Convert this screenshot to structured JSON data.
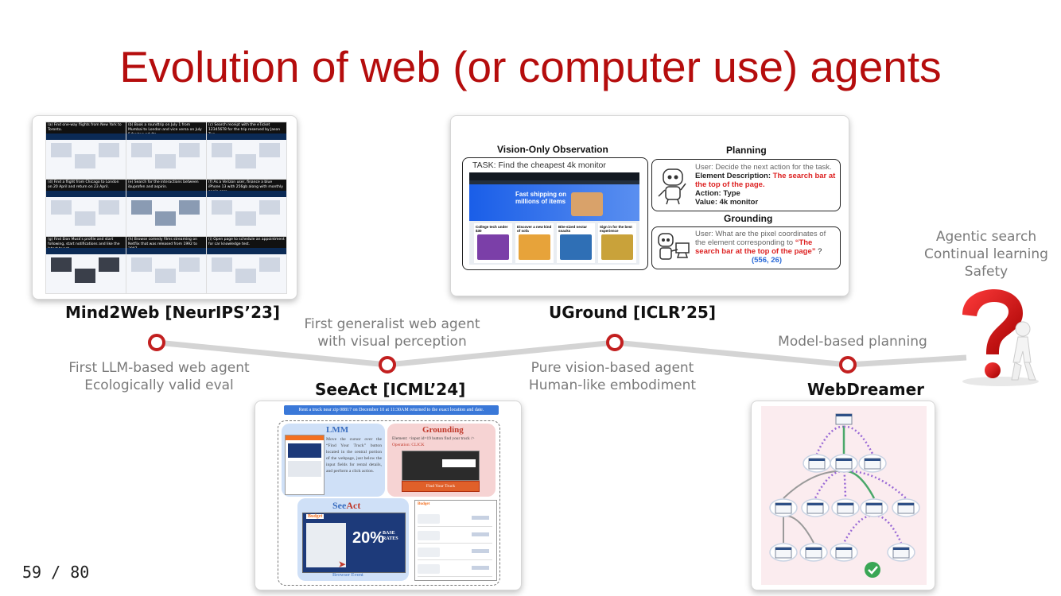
{
  "slide": {
    "title": "Evolution of web (or computer use) agents",
    "page_number": "59 / 80"
  },
  "colors": {
    "title_red": "#b50d0d",
    "node_red": "#c21f1f",
    "line_gray": "#d4d4d4",
    "text_gray": "#7a7a7a"
  },
  "milestones": [
    {
      "label": "Mind2Web [NeurIPS’23]",
      "description": [
        "First LLM-based web agent",
        "Ecologically valid eval"
      ]
    },
    {
      "label": "SeeAct [ICML’24]",
      "description": [
        "First generalist web agent",
        "with visual perception"
      ]
    },
    {
      "label": "UGround [ICLR’25]",
      "description": [
        "Pure vision-based agent",
        "Human-like embodiment"
      ]
    },
    {
      "label": "WebDreamer",
      "description": [
        "Model-based planning"
      ]
    }
  ],
  "future": {
    "lines": [
      "Agentic search",
      "Continual learning",
      "Safety"
    ],
    "icon": "question-mark-figure-icon"
  },
  "mind2web_figure": {
    "captions": [
      "(a) Find one-way flights from New York to Toronto.",
      "(b) Book a roundtrip on July 1 from Mumbai to London and vice versa on July 5 for two adults...",
      "(c) Search receipt with the eTicket 12345678 for the trip reserved by Jason Two",
      "(d) Find a flight from Chicago to London on 20 April and return on 23 April.",
      "(e) Search for the interactions between ibuprofen and aspirin.",
      "(f) As a Verizon user, finance a blue iPhone 13 with 256gb along with monthly apple care.",
      "(g) Find Elon Musk's profile and start following, start notifications and like the latest tweet.",
      "(h) Browse comedy films streaming on Netflix that was released from 1992 to 2007.",
      "(i) Open page to schedule an appointment for car knowledge test."
    ],
    "inner_texts": {
      "search_receipt": "Search receipt",
      "drugs_checker": "Drugs Interaction Checker",
      "logo": "ME"
    }
  },
  "uground_figure": {
    "observation_title": "Vision-Only Observation",
    "task": "TASK: Find the cheapest 4k monitor",
    "banner": "Fast shipping on millions of items",
    "products": [
      "College tech under $30",
      "Discover a new kind of sofa",
      "Bite-sized nectar snacks",
      "Sign in for the best experience"
    ],
    "planning_title": "Planning",
    "planning_user": "User: Decide the next action for the task.",
    "element_desc_label": "Element Description:",
    "element_desc_value": "The search bar at the top of the page.",
    "action_line": "Action: Type",
    "value_line": "Value: 4k monitor",
    "grounding_title": "Grounding",
    "grounding_user": "User: What are the pixel coordinates of the element corresponding to",
    "grounding_quote": "“The search bar at the top of the page”",
    "grounding_q": "?",
    "grounding_answer": "(556, 26)"
  },
  "seeact_figure": {
    "task": "Rent a truck near zip 08817 on December 10 at 11:30AM returned to the exact location and date.",
    "lmm_title": "LMM",
    "lmm_text": "Move the cursor over the “Find Your Truck” button located in the central portion of the webpage, just below the input fields for rental details, and perform a click action.",
    "grounding_title": "Grounding",
    "grounding_element": "Element: <input id=19 button find your truck />",
    "grounding_operation": "Operation: CLICK",
    "find_button": "Find Your Truck",
    "seeact_title_see": "See",
    "seeact_title_act": "Act",
    "promo": "20%",
    "promo_sub": "BASE RATES",
    "browser_event": "Browser Event",
    "brand": "Budget"
  }
}
